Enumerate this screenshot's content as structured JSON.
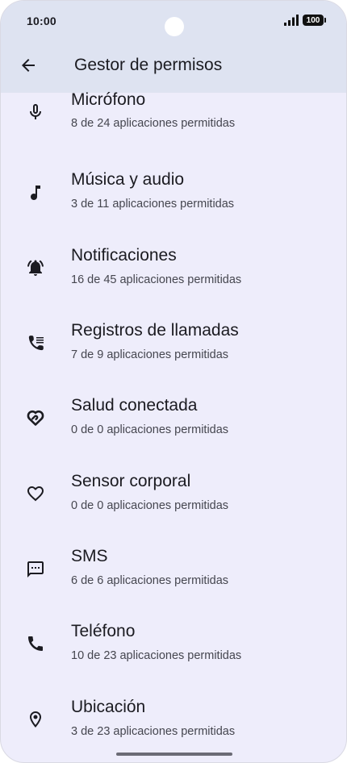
{
  "status_bar": {
    "time": "10:00",
    "battery": "100",
    "icons": [
      "signal-icon",
      "battery-icon"
    ]
  },
  "app_bar": {
    "back_icon": "arrow-back-icon",
    "title": "Gestor de permisos"
  },
  "permissions": [
    {
      "title": "Micrófono",
      "subtitle": "8 de 24 aplicaciones permitidas",
      "icon": "microphone-icon"
    },
    {
      "title": "Música y audio",
      "subtitle": "3 de 11 aplicaciones permitidas",
      "icon": "music-note-icon"
    },
    {
      "title": "Notificaciones",
      "subtitle": "16 de 45 aplicaciones permitidas",
      "icon": "notification-bell-icon"
    },
    {
      "title": "Registros de llamadas",
      "subtitle": "7 de 9 aplicaciones permitidas",
      "icon": "call-log-icon"
    },
    {
      "title": "Salud conectada",
      "subtitle": "0 de 0 aplicaciones permitidas",
      "icon": "health-connect-icon"
    },
    {
      "title": "Sensor corporal",
      "subtitle": "0 de 0 aplicaciones permitidas",
      "icon": "heart-icon"
    },
    {
      "title": "SMS",
      "subtitle": "6 de 6 aplicaciones permitidas",
      "icon": "sms-icon"
    },
    {
      "title": "Teléfono",
      "subtitle": "10 de 23 aplicaciones permitidas",
      "icon": "phone-icon"
    },
    {
      "title": "Ubicación",
      "subtitle": "3 de 23 aplicaciones permitidas",
      "icon": "location-pin-icon"
    }
  ],
  "colors": {
    "background": "#eeedfb",
    "app_bar": "#dee3f1",
    "text_primary": "#1b1b21",
    "text_secondary": "#45464f",
    "icon": "#1b1b21"
  }
}
